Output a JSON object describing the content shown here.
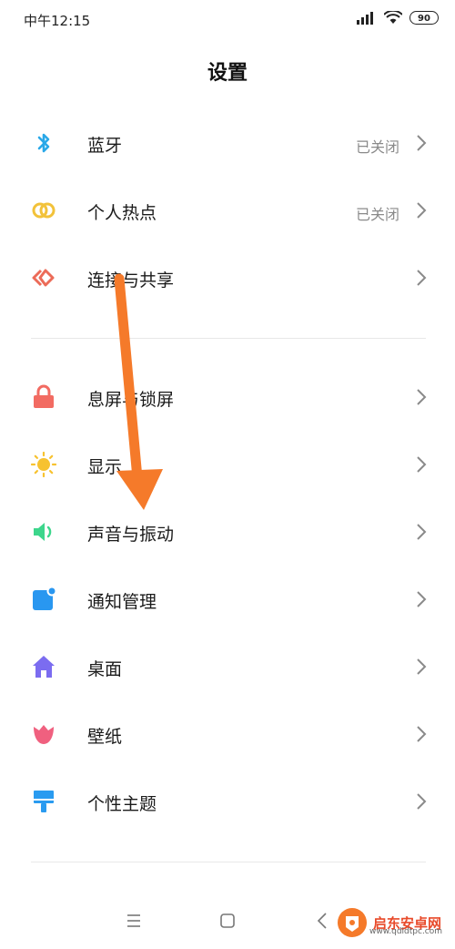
{
  "status_bar": {
    "time": "中午12:15",
    "battery": "90"
  },
  "page": {
    "title": "设置"
  },
  "groups": [
    {
      "items": [
        {
          "label": "蓝牙",
          "value": "已关闭",
          "icon": "bluetooth-icon",
          "color": "#2aa8e8"
        },
        {
          "label": "个人热点",
          "value": "已关闭",
          "icon": "hotspot-icon",
          "color": "#f2c23a"
        },
        {
          "label": "连接与共享",
          "value": "",
          "icon": "connection-share-icon",
          "color": "#ec6b58"
        }
      ]
    },
    {
      "items": [
        {
          "label": "息屏与锁屏",
          "icon": "lock-icon",
          "color": "#f26b62"
        },
        {
          "label": "显示",
          "icon": "sun-icon",
          "color": "#f7c230"
        },
        {
          "label": "声音与振动",
          "icon": "speaker-icon",
          "color": "#3dd68c"
        },
        {
          "label": "通知管理",
          "icon": "notification-icon",
          "color": "#2997f0"
        },
        {
          "label": "桌面",
          "icon": "home-icon",
          "color": "#7b6cf0"
        },
        {
          "label": "壁纸",
          "icon": "wallpaper-flower-icon",
          "color": "#f0607f"
        },
        {
          "label": "个性主题",
          "icon": "theme-brush-icon",
          "color": "#2a9bf0"
        }
      ]
    }
  ],
  "annotation": {
    "color": "#f57a2a"
  },
  "watermark": {
    "text": "启东安卓网",
    "url": "www.qdldtpc.com"
  }
}
